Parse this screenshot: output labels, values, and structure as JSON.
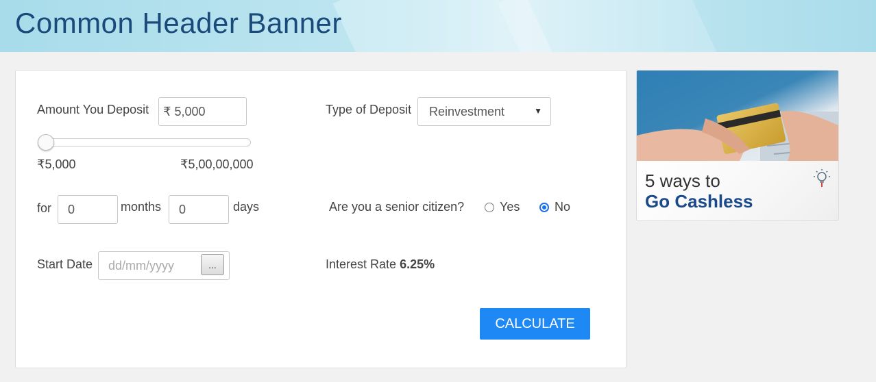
{
  "banner": {
    "title": "Common Header Banner"
  },
  "form": {
    "amount_label": "Amount You Deposit",
    "amount_value": "₹ 5,000",
    "slider_min": "₹5,000",
    "slider_max": "₹5,00,00,000",
    "slider_fraction": 0,
    "deposit_type_label": "Type of Deposit",
    "deposit_type_value": "Reinvestment",
    "for_label": "for",
    "months_value": "0",
    "months_label": "months",
    "days_value": "0",
    "days_label": "days",
    "senior_label": "Are you a senior citizen?",
    "senior_options": {
      "yes": "Yes",
      "no": "No"
    },
    "senior_selected": "No",
    "start_date_label": "Start Date",
    "start_date_placeholder": "dd/mm/yyyy",
    "date_picker_label": "...",
    "interest_label": "Interest Rate",
    "interest_value": "6.25%",
    "calculate_label": "CALCULATE"
  },
  "ad": {
    "line1": "5 ways to",
    "line2": "Go Cashless",
    "image_icon": "credit-card-hands",
    "badge_icon": "lightbulb-icon"
  },
  "colors": {
    "button": "#1e88f5",
    "radio_selected": "#1a73e8",
    "banner_title": "#1a4a7a",
    "ad_title": "#1a4a8a"
  }
}
